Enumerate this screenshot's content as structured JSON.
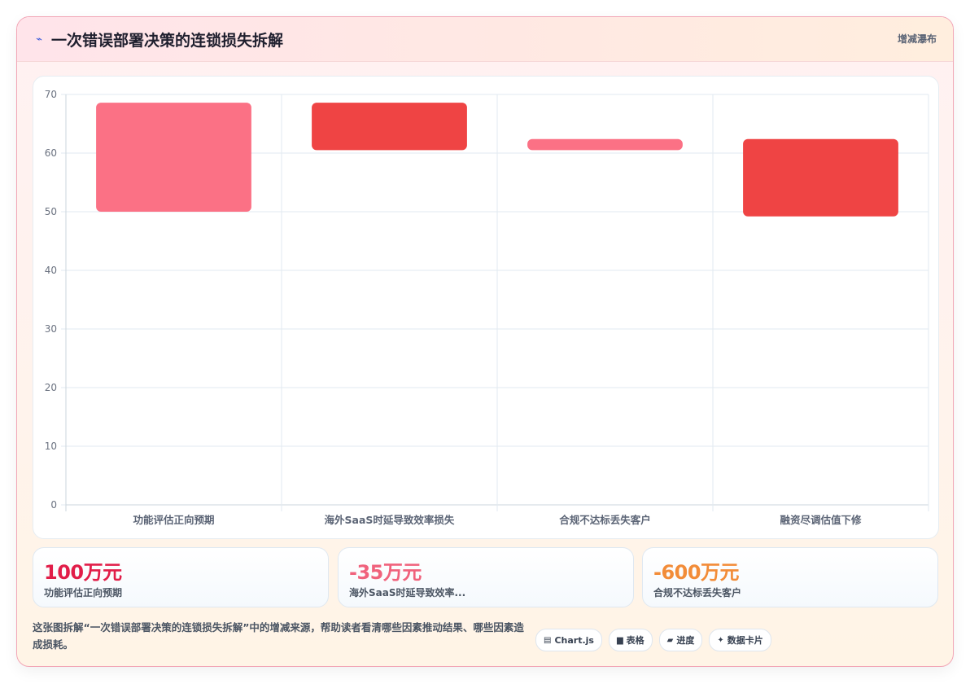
{
  "header": {
    "icon": "lightning-icon",
    "title": "一次错误部署决策的连锁损失拆解",
    "tag": "增减瀑布"
  },
  "chart_data": {
    "type": "bar",
    "subtype": "floating-waterfall",
    "categories": [
      "功能评估正向预期",
      "海外SaaS时延导致效率损失",
      "合规不达标丢失客户",
      "融资尽调估值下修"
    ],
    "ranges": [
      [
        50,
        68.6
      ],
      [
        60.5,
        68.6
      ],
      [
        60.5,
        62.4
      ],
      [
        49.2,
        62.4
      ]
    ],
    "colors": [
      "#fb7185",
      "#ef4444",
      "#fb7185",
      "#ef4444"
    ],
    "ylim": [
      0,
      70
    ],
    "yticks": [
      0,
      10,
      20,
      30,
      40,
      50,
      60,
      70
    ],
    "grid": true,
    "legend": "none"
  },
  "kpis": [
    {
      "value": "100万元",
      "label": "功能评估正向预期",
      "color": "#e11d48"
    },
    {
      "value": "-35万元",
      "label": "海外SaaS时延导致效率...",
      "color": "#f0627c"
    },
    {
      "value": "-600万元",
      "label": "合规不达标丢失客户",
      "color": "#f28c38"
    }
  ],
  "description": "这张图拆解“一次错误部署决策的连锁损失拆解”中的增减来源，帮助读者看清哪些因素推动结果、哪些因素造成损耗。",
  "chips": [
    {
      "icon": "chart-icon",
      "glyph": "▤",
      "label": "Chart.js"
    },
    {
      "icon": "table-icon",
      "glyph": "▆",
      "label": "表格"
    },
    {
      "icon": "progress-icon",
      "glyph": "▰",
      "label": "进度"
    },
    {
      "icon": "sparkle-icon",
      "glyph": "✦",
      "label": "数据卡片"
    }
  ]
}
